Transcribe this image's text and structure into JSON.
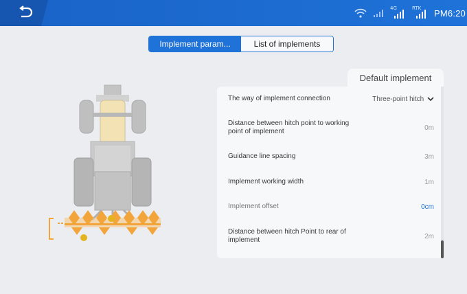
{
  "status_bar": {
    "clock": "PM6:20",
    "signal_4g_label": "4G",
    "signal_rtk_label": "RTK"
  },
  "tabs": [
    {
      "label": "Implement param...",
      "active": true
    },
    {
      "label": "List of implements",
      "active": false
    }
  ],
  "panel": {
    "title": "Default implement",
    "rows": [
      {
        "label": "The way of implement connection",
        "value": "Three-point hitch",
        "has_dropdown": true
      },
      {
        "label": "Distance between hitch point to working point of implement",
        "value": "0m"
      },
      {
        "label": "Guidance line spacing",
        "value": "3m"
      },
      {
        "label": "Implement working width",
        "value": "1m"
      },
      {
        "label": "Implement offset",
        "value": "0cm"
      },
      {
        "label": "Distance between hitch Point to rear of implement",
        "value": "2m"
      }
    ]
  },
  "colors": {
    "accent": "#1e72d8",
    "implement_orange": "#f2a53a",
    "background": "#ebedf1"
  }
}
